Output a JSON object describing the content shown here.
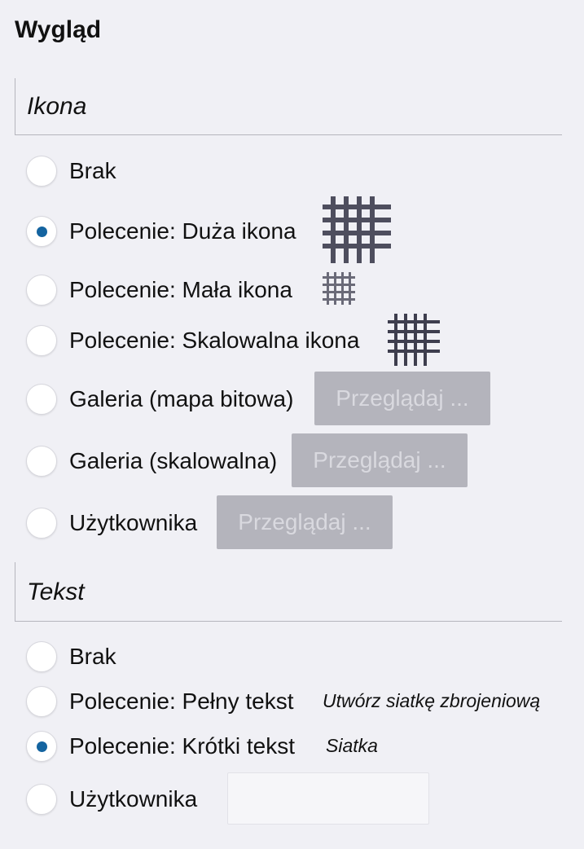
{
  "appearance": {
    "title": "Wygląd"
  },
  "icon_section": {
    "title": "Ikona",
    "options": [
      {
        "label": "Brak",
        "selected": false
      },
      {
        "label": "Polecenie: Duża ikona",
        "selected": true,
        "icon": "grid-large-icon"
      },
      {
        "label": "Polecenie: Mała ikona",
        "selected": false,
        "icon": "grid-small-icon"
      },
      {
        "label": "Polecenie: Skalowalna ikona",
        "selected": false,
        "icon": "grid-scalable-icon"
      },
      {
        "label": "Galeria (mapa bitowa)",
        "selected": false,
        "browse_label": "Przeglądaj ..."
      },
      {
        "label": "Galeria (skalowalna)",
        "selected": false,
        "browse_label": "Przeglądaj ..."
      },
      {
        "label": "Użytkownika",
        "selected": false,
        "browse_label": "Przeglądaj ..."
      }
    ]
  },
  "text_section": {
    "title": "Tekst",
    "options": [
      {
        "label": "Brak",
        "selected": false
      },
      {
        "label": "Polecenie: Pełny tekst",
        "selected": false,
        "preview": "Utwórz siatkę zbrojeniową"
      },
      {
        "label": "Polecenie: Krótki tekst",
        "selected": true,
        "preview": "Siatka"
      },
      {
        "label": "Użytkownika",
        "selected": false,
        "value": ""
      }
    ]
  },
  "colors": {
    "background": "#f0f0f5",
    "radio_selected": "#1464a0",
    "button_disabled": "#b4b4bc",
    "icon_grid": "#4e4e5e"
  }
}
